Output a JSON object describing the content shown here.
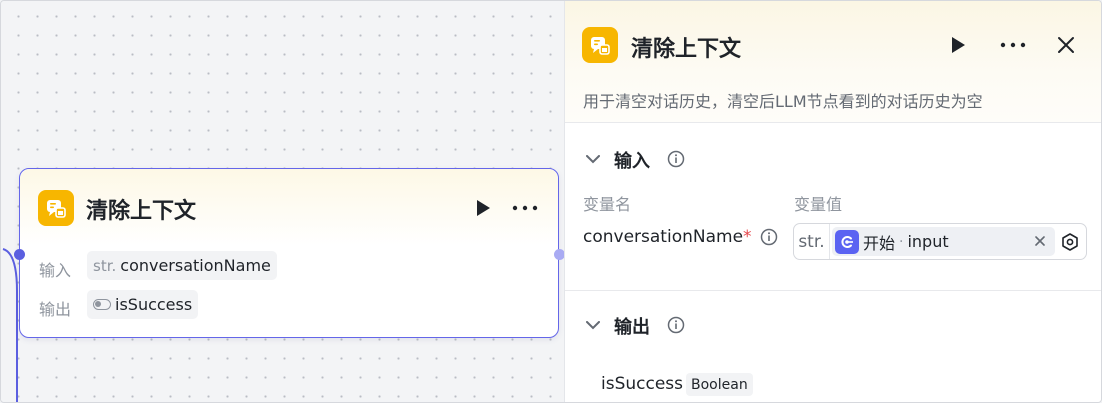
{
  "node": {
    "title": "清除上下文",
    "input_label": "输入",
    "input_type": "str.",
    "input_name": "conversationName",
    "output_label": "输出",
    "output_name": "isSuccess",
    "icon": "clear-context-icon"
  },
  "panel": {
    "title": "清除上下文",
    "description": "用于清空对话历史，清空后LLM节点看到的对话历史为空",
    "input_section": {
      "title": "输入",
      "col_name": "变量名",
      "col_value": "变量值",
      "var_name": "conversationName",
      "required_mark": "*",
      "value_type": "str.",
      "ref_source": "开始",
      "ref_separator": "·",
      "ref_var": "input"
    },
    "output_section": {
      "title": "输出",
      "var_name": "isSuccess",
      "var_type": "Boolean"
    }
  },
  "colors": {
    "accent": "#6466e9",
    "node_icon_bg": "#f7b600",
    "ref_icon_bg": "#5b63f2",
    "required": "#e5484d"
  }
}
